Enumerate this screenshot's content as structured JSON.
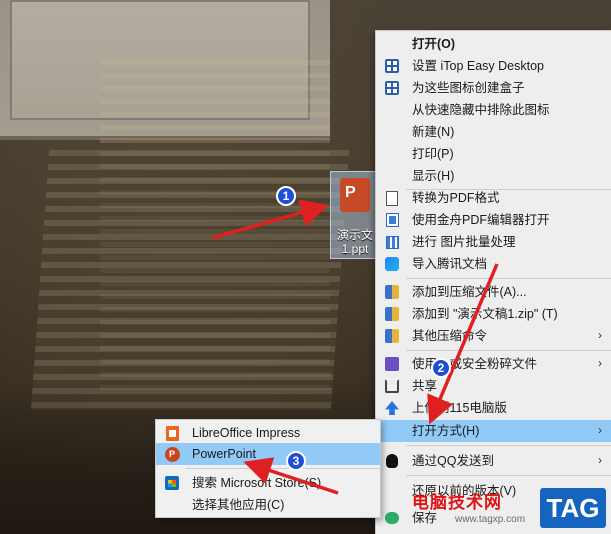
{
  "desktop": {
    "file_icon": {
      "name_line1": "演示文",
      "name_line2": "1.ppt",
      "glyph": "P"
    }
  },
  "context_menu": {
    "items": [
      {
        "label": "打开(O)",
        "icon": "",
        "bold": true
      },
      {
        "label": "设置 iTop Easy Desktop",
        "icon": "itop-tile-icon"
      },
      {
        "label": "为这些图标创建盒子",
        "icon": "itop-tile-icon"
      },
      {
        "label": "从快速隐藏中排除此图标",
        "icon": ""
      },
      {
        "label": "新建(N)",
        "icon": ""
      },
      {
        "label": "打印(P)",
        "icon": ""
      },
      {
        "label": "显示(H)",
        "icon": ""
      },
      {
        "label": "转换为PDF格式",
        "icon": "document-icon"
      },
      {
        "label": "使用金舟PDF编辑器打开",
        "icon": "pdf-editor-icon"
      },
      {
        "label": "进行 图片批量处理",
        "icon": "image-batch-icon"
      },
      {
        "label": "导入腾讯文档",
        "icon": "tencent-docs-icon"
      },
      {
        "label": "添加到压缩文件(A)...",
        "icon": "archive-icon"
      },
      {
        "label": "添加到 \"演示文稿1.zip\" (T)",
        "icon": "archive-icon"
      },
      {
        "label": "其他压缩命令",
        "icon": "archive-icon",
        "submenu": true
      },
      {
        "label": "使用…或安全粉碎文件",
        "icon": "shredder-icon",
        "submenu": true
      },
      {
        "label": "共享",
        "icon": "share-icon"
      },
      {
        "label": "上传到115电脑版",
        "icon": "upload-icon"
      },
      {
        "label": "打开方式(H)",
        "icon": "",
        "submenu": true,
        "highlighted": true
      },
      {
        "label": "通过QQ发送到",
        "icon": "qq-icon",
        "submenu": true
      },
      {
        "label": "还原以前的版本(V)",
        "icon": ""
      },
      {
        "label": "保存",
        "icon": "wechat-icon"
      }
    ]
  },
  "open_with_submenu": {
    "items": [
      {
        "label": "LibreOffice Impress",
        "icon": "libreoffice-impress-icon"
      },
      {
        "label": "PowerPoint",
        "icon": "powerpoint-icon",
        "highlighted": true
      },
      {
        "label": "搜索 Microsoft Store(S)",
        "icon": "microsoft-store-icon"
      },
      {
        "label": "选择其他应用(C)",
        "icon": ""
      }
    ]
  },
  "annotations": {
    "step1": "1",
    "step2": "2",
    "step3": "3",
    "arrow_color": "#e02020",
    "badge_color": "#1f4fd8"
  },
  "watermark": {
    "site_name": "电脑技术网",
    "url": "www.tagxp.com",
    "tag": "TAG"
  },
  "colors": {
    "menu_bg": "#eeeeee",
    "highlight": "#91c9f7"
  }
}
